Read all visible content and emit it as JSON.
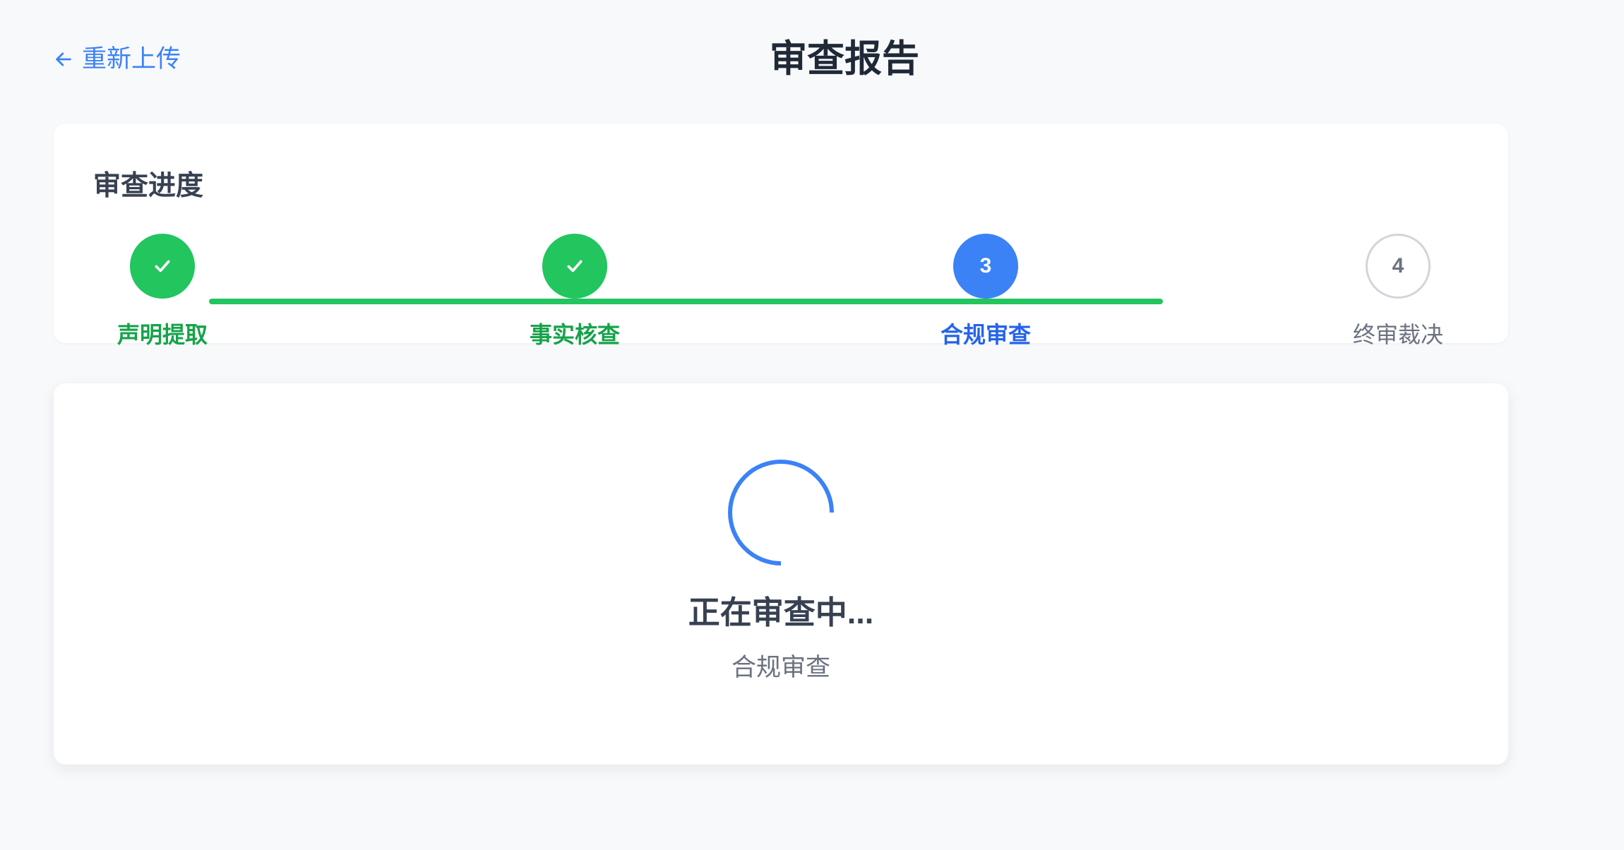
{
  "header": {
    "back_icon": "arrow-left-icon",
    "back_label": "重新上传",
    "title": "审查报告"
  },
  "progress": {
    "title": "审查进度",
    "fill_percent": 66.7,
    "steps": [
      {
        "label": "声明提取",
        "status": "completed",
        "icon": "check-icon"
      },
      {
        "label": "事实核查",
        "status": "completed",
        "icon": "check-icon"
      },
      {
        "label": "合规审查",
        "status": "current",
        "number": "3"
      },
      {
        "label": "终审裁决",
        "status": "pending",
        "number": "4"
      }
    ]
  },
  "status": {
    "icon": "loading-spinner-icon",
    "message": "正在审查中...",
    "stage": "合规审查"
  },
  "colors": {
    "accent_blue": "#3b82f6",
    "success_green": "#22c55e",
    "success_text": "#16a34a",
    "current_text": "#2563eb",
    "pending_gray": "#6b7280",
    "background": "#f8f9fb"
  }
}
